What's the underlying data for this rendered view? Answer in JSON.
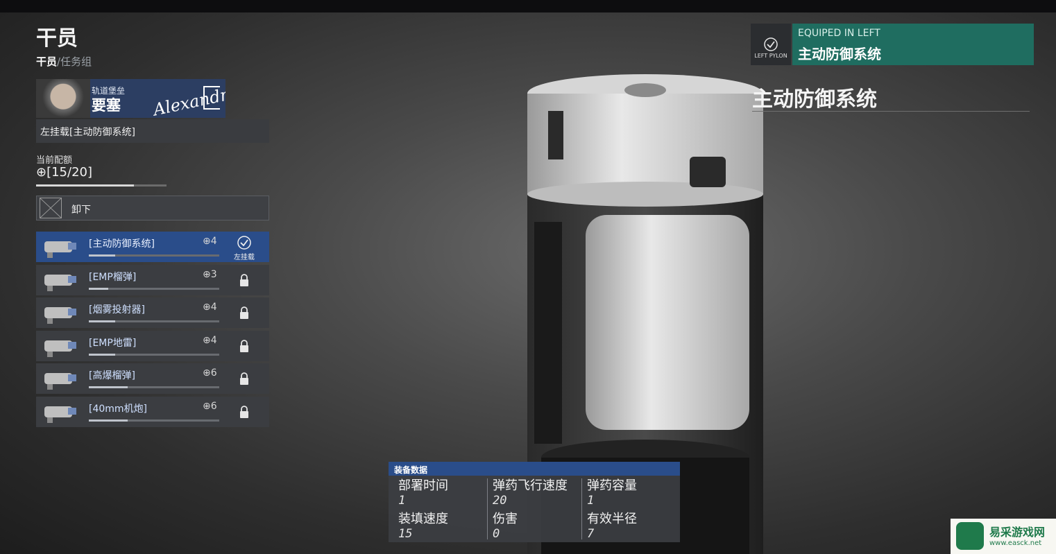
{
  "page": {
    "title": "干员",
    "breadcrumb": {
      "current": "干员",
      "separator": "/",
      "next": "任务组"
    }
  },
  "operator": {
    "subtitle": "轨道堡垒",
    "name": "要塞",
    "signature": "Alexandra"
  },
  "loadout": {
    "label": "左挂载[主动防御系统]"
  },
  "quota": {
    "label": "当前配额",
    "value": "⊕[15/20]",
    "used": 15,
    "max": 20
  },
  "unequip": {
    "label": "卸下"
  },
  "items": [
    {
      "name": "[主动防御系统]",
      "cost": "⊕4",
      "status": "equipped",
      "status_label": "左挂载",
      "selected": true,
      "bar": 0.2
    },
    {
      "name": "[EMP榴弹]",
      "cost": "⊕3",
      "status": "locked",
      "status_label": "",
      "selected": false,
      "bar": 0.15
    },
    {
      "name": "[烟雾投射器]",
      "cost": "⊕4",
      "status": "locked",
      "status_label": "",
      "selected": false,
      "bar": 0.2
    },
    {
      "name": "[EMP地雷]",
      "cost": "⊕4",
      "status": "locked",
      "status_label": "",
      "selected": false,
      "bar": 0.2
    },
    {
      "name": "[高爆榴弹]",
      "cost": "⊕6",
      "status": "locked",
      "status_label": "",
      "selected": false,
      "bar": 0.3
    },
    {
      "name": "[40mm机炮]",
      "cost": "⊕6",
      "status": "locked",
      "status_label": "",
      "selected": false,
      "bar": 0.3
    }
  ],
  "equipped_banner": {
    "slot_label": "LEFT PYLON",
    "heading": "EQUIPED IN LEFT",
    "name": "主动防御系统"
  },
  "detail_title": "主动防御系统",
  "stats": {
    "header": "装备数据",
    "deploy_time": {
      "label": "部署时间",
      "value": "1"
    },
    "reload_speed": {
      "label": "装填速度",
      "value": "15"
    },
    "projectile_speed": {
      "label": "弹药飞行速度",
      "value": "20"
    },
    "damage": {
      "label": "伤害",
      "value": "0"
    },
    "ammo_capacity": {
      "label": "弹药容量",
      "value": "1"
    },
    "effective_radius": {
      "label": "有效半径",
      "value": "7"
    }
  },
  "watermark": {
    "name": "易采游戏网",
    "url": "www.easck.net"
  },
  "colors": {
    "accent_blue": "#2a4d8a",
    "accent_teal": "#1f6d60",
    "panel": "#3b3d41"
  }
}
